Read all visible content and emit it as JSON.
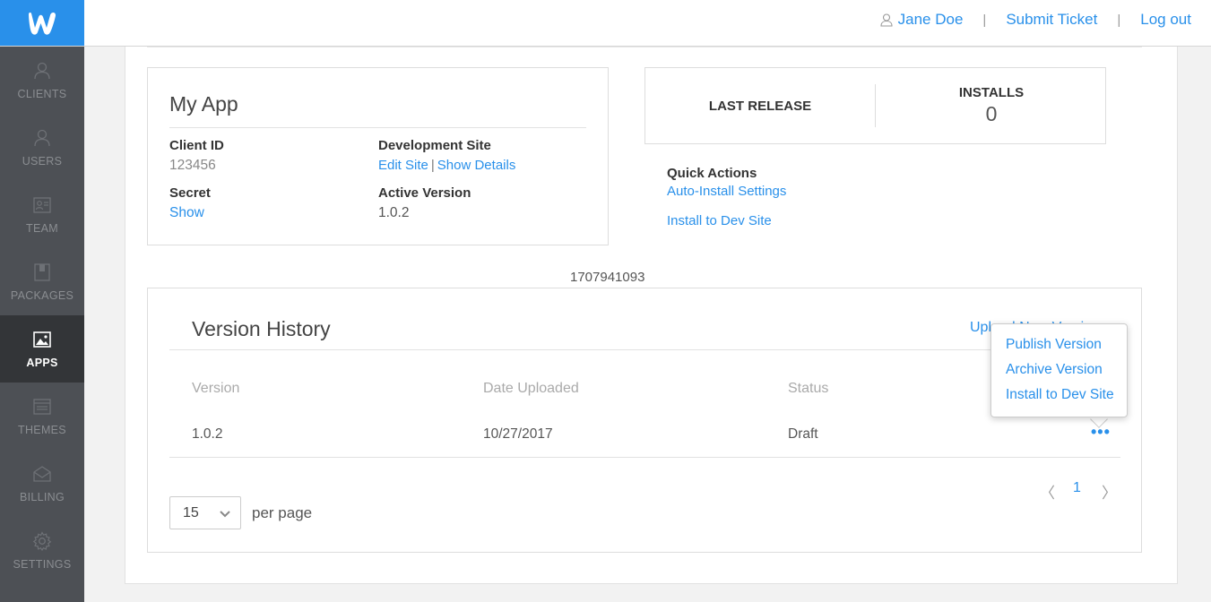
{
  "header": {
    "user_name": "Jane Doe",
    "submit_ticket": "Submit Ticket",
    "log_out": "Log out",
    "separator": "|"
  },
  "sidebar": {
    "items": [
      {
        "label": "CLIENTS",
        "icon": "user-icon"
      },
      {
        "label": "USERS",
        "icon": "user-icon"
      },
      {
        "label": "TEAM",
        "icon": "team-card-icon"
      },
      {
        "label": "PACKAGES",
        "icon": "package-icon"
      },
      {
        "label": "APPS",
        "icon": "image-icon",
        "active": true
      },
      {
        "label": "THEMES",
        "icon": "themes-icon"
      },
      {
        "label": "BILLING",
        "icon": "billing-icon"
      },
      {
        "label": "SETTINGS",
        "icon": "gear-icon"
      }
    ]
  },
  "app": {
    "name": "My App",
    "client_id_label": "Client ID",
    "client_id": "123456",
    "secret_label": "Secret",
    "secret_show": "Show",
    "dev_site_label": "Development Site",
    "edit_site": "Edit Site",
    "pipe": "|",
    "show_details": "Show Details",
    "active_version_label": "Active Version",
    "active_version": "1.0.2"
  },
  "stats": {
    "last_release_label": "LAST RELEASE",
    "installs_label": "INSTALLS",
    "installs_value": "0"
  },
  "quick_actions": {
    "label": "Quick Actions",
    "auto_install": "Auto-Install Settings",
    "install_dev": "Install to Dev Site"
  },
  "timestamp": "1707941093",
  "versions": {
    "title": "Version History",
    "upload_link": "Upload New Version",
    "columns": {
      "version": "Version",
      "date": "Date Uploaded",
      "status": "Status"
    },
    "rows": [
      {
        "version": "1.0.2",
        "date": "10/27/2017",
        "status": "Draft",
        "actions": "•••"
      }
    ],
    "pagination": {
      "prev": "〈",
      "current": "1",
      "next": "〉"
    },
    "per_page_value": "15",
    "per_page_label": "per page"
  },
  "row_menu": {
    "items": [
      "Publish Version",
      "Archive Version",
      "Install to Dev Site"
    ]
  },
  "colors": {
    "accent": "#2990ea",
    "sidebar": "#4d5055",
    "sidebar_active": "#333538"
  }
}
